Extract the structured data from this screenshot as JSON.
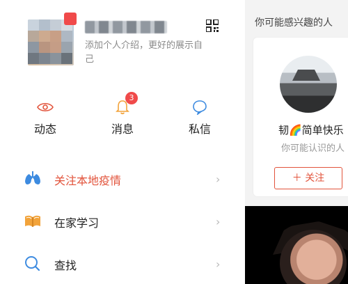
{
  "profile": {
    "intro_visible": "添加个人介绍，更好的展示自己"
  },
  "quick_actions": [
    {
      "label": "动态",
      "icon": "eye-icon"
    },
    {
      "label": "消息",
      "icon": "bell-icon",
      "badge": "3"
    },
    {
      "label": "私信",
      "icon": "chat-bubble-icon"
    }
  ],
  "menu": [
    {
      "label": "关注本地疫情",
      "icon": "lungs-icon",
      "highlight": true
    },
    {
      "label": "在家学习",
      "icon": "book-icon",
      "highlight": false
    },
    {
      "label": "查找",
      "icon": "search-icon",
      "highlight": false
    }
  ],
  "right_panel": {
    "title": "你可能感兴趣的人",
    "card": {
      "name": "韧🌈简单快乐",
      "subtitle": "你可能认识的人",
      "follow_label": "＋ 关注",
      "close": "×"
    }
  },
  "colors": {
    "accent": "#e2533b",
    "badge": "#f04a4a",
    "blue_icon": "#3d8be0"
  }
}
